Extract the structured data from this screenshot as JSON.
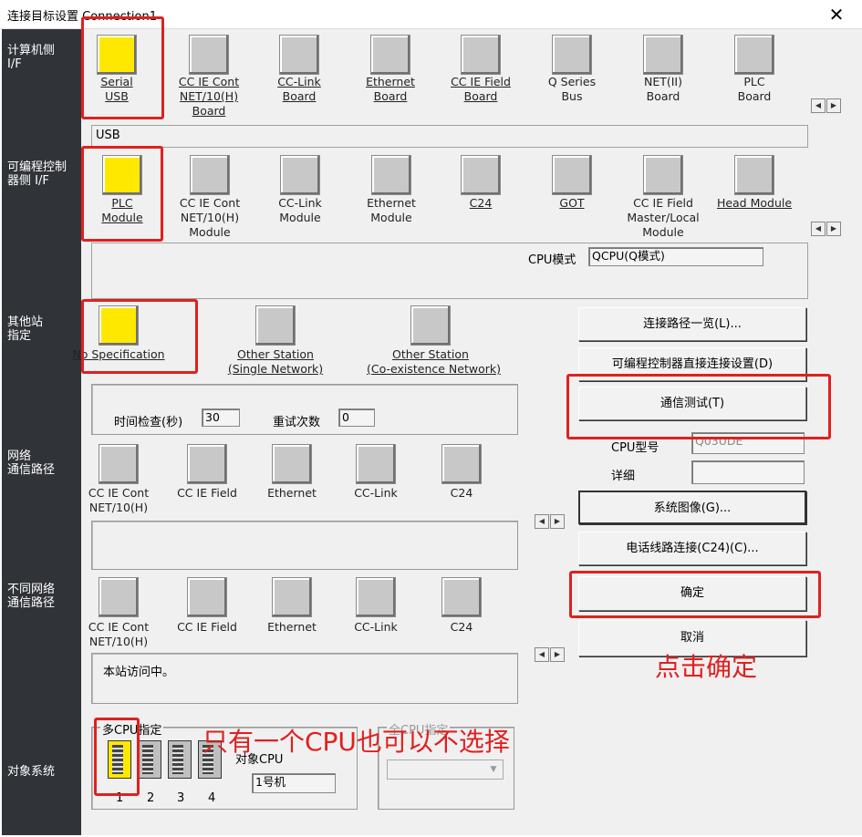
{
  "window": {
    "title": "连接目标设置 Connection1",
    "close": "✕"
  },
  "sidebar": {
    "pc_if": "计算机侧\nI/F",
    "plc_if": "可编程控制\n器侧 I/F",
    "other_station": "其他站\n指定",
    "network_route": "网络\n通信路径",
    "diff_network": "不同网络\n通信路径",
    "target_system": "对象系统"
  },
  "pc_if": {
    "items": [
      "Serial\nUSB",
      "CC IE Cont\nNET/10(H)\nBoard",
      "CC-Link\nBoard",
      "Ethernet\nBoard",
      "CC IE Field\nBoard",
      "Q Series\nBus",
      "NET(II)\nBoard",
      "PLC\nBoard"
    ],
    "selected_value": "USB"
  },
  "plc_if": {
    "items": [
      "PLC\nModule",
      "CC IE Cont\nNET/10(H)\nModule",
      "CC-Link\nModule",
      "Ethernet\nModule",
      "C24",
      "GOT",
      "CC IE Field\nMaster/Local\nModule",
      "Head Module"
    ],
    "cpu_mode_label": "CPU模式",
    "cpu_mode_value": "QCPU(Q模式)"
  },
  "other_station": {
    "items": [
      "No Specification",
      "Other Station\n(Single Network)",
      "Other Station\n(Co-existence Network)"
    ],
    "time_check_label": "时间检查(秒)",
    "time_check_value": "30",
    "retry_label": "重试次数",
    "retry_value": "0"
  },
  "network_route": {
    "items": [
      "CC IE Cont\nNET/10(H)",
      "CC IE Field",
      "Ethernet",
      "CC-Link",
      "C24"
    ]
  },
  "diff_network": {
    "items": [
      "CC IE Cont\nNET/10(H)",
      "CC IE Field",
      "Ethernet",
      "CC-Link",
      "C24"
    ],
    "status": "本站访问中。"
  },
  "target_system": {
    "multi_cpu_label": "多CPU指定",
    "cpu_numbers": [
      "1",
      "2",
      "3",
      "4"
    ],
    "target_cpu_label": "对象CPU",
    "target_cpu_value": "1号机",
    "all_cpu_label": "全CPU指定"
  },
  "buttons": {
    "route_list": "连接路径一览(L)...",
    "direct_connect": "可编程控制器直接连接设置(D)",
    "comm_test": "通信测试(T)",
    "system_image": "系统图像(G)...",
    "phone_line": "电话线路连接(C24)(C)...",
    "ok": "确定",
    "cancel": "取消"
  },
  "cpu_info": {
    "model_label": "CPU型号",
    "model_value": "Q03UDE",
    "detail_label": "详细"
  },
  "annotations": {
    "click_ok": "点击确定",
    "one_cpu": "只有一个CPU也可以不选择"
  },
  "colors": {
    "highlight": "#ffe800",
    "annotation": "#e02020",
    "sidebar": "#303338"
  }
}
